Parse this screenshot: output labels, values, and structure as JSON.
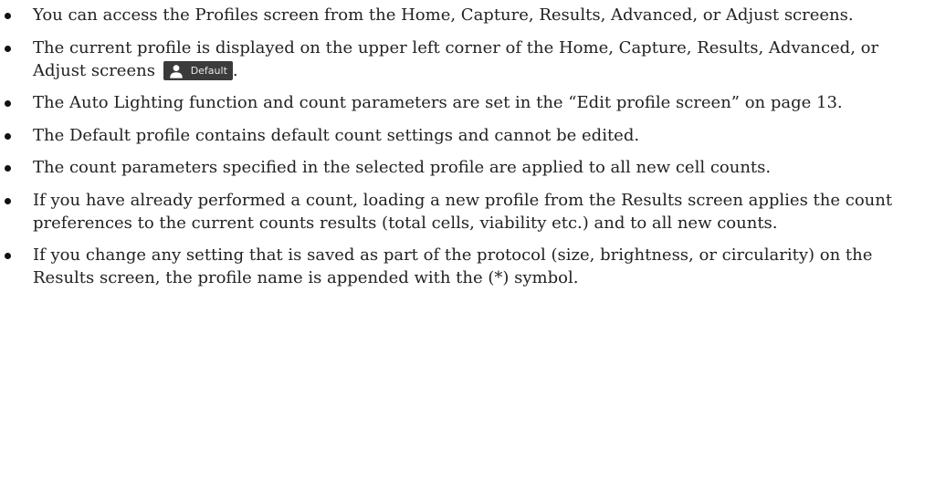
{
  "bullets": [
    {
      "text": "You can access the Profiles screen from the Home, Capture, Results, Advanced, or Adjust screens."
    },
    {
      "text": "The current profile is displayed on the upper left corner of the Home, Capture, Results, Advanced, or Adjust screens",
      "chip_label": "Default",
      "after": "."
    },
    {
      "text": "The Auto Lighting function and count parameters are set in the “Edit profile screen” on page 13."
    },
    {
      "text": "The Default profile contains default count settings and cannot be edited."
    },
    {
      "text": "The count parameters specified in the selected profile are applied to all new cell counts."
    },
    {
      "text": "If you have already performed a count, loading a new profile from the Results screen applies the count preferences to the current counts results (total cells, viability etc.) and to all new counts."
    },
    {
      "text": "If you change any setting that is saved as part of the protocol (size, brightness, or circularity) on the Results screen, the profile name is appended with the (*) symbol."
    }
  ],
  "colors": {
    "chip_background": "#3b3b3b",
    "chip_icon": "#ffffff",
    "chip_text": "#e8e8e8"
  }
}
